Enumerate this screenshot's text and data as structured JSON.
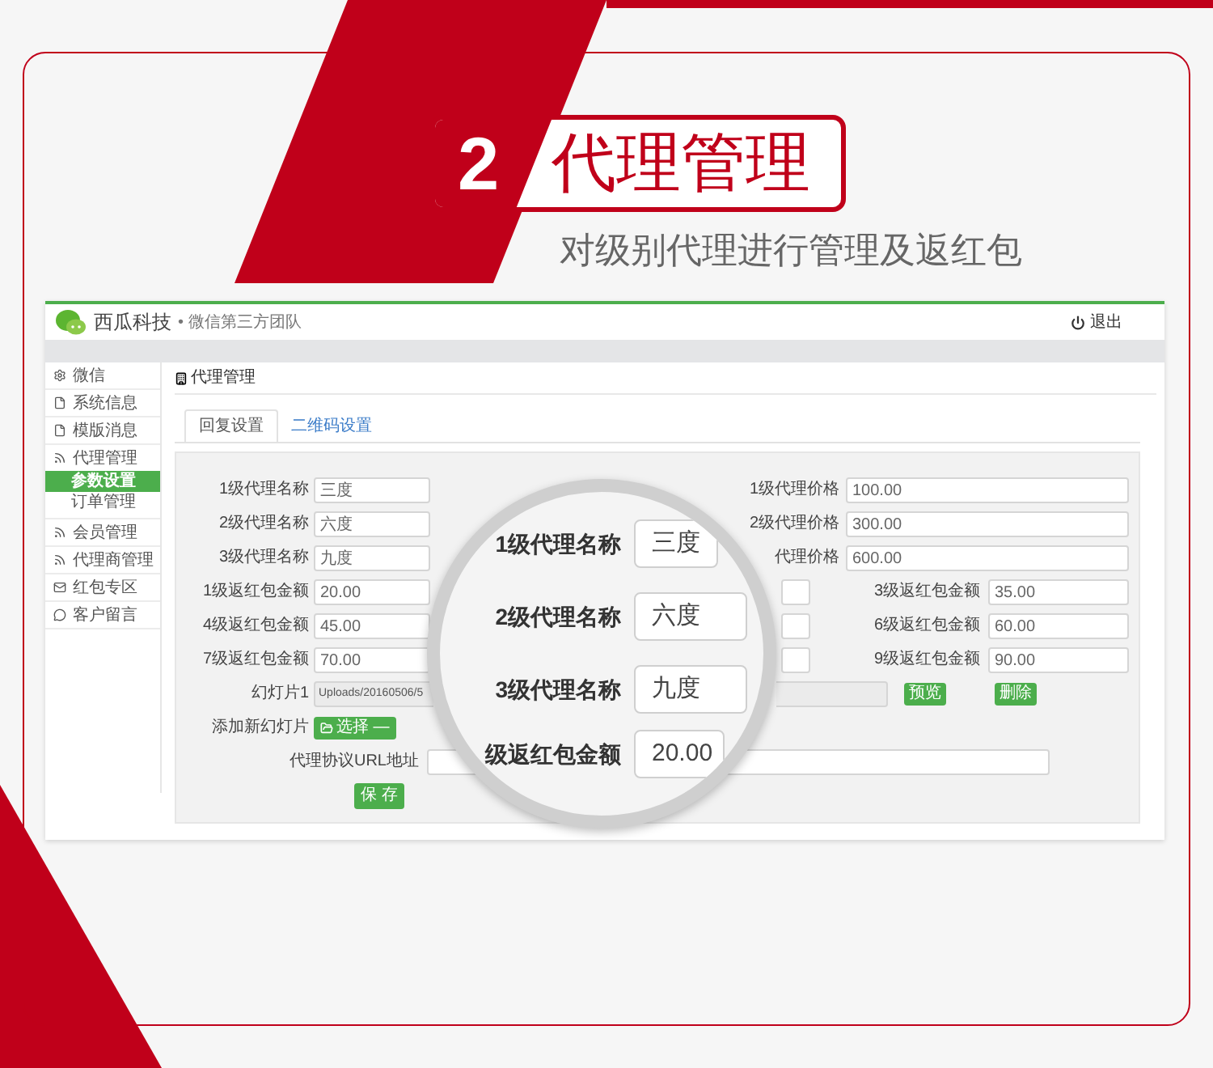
{
  "banner": {
    "number": "2",
    "title": "代理管理",
    "subtitle": "对级别代理进行管理及返红包"
  },
  "app": {
    "brand": "西瓜科技",
    "tagline": "• 微信第三方团队",
    "logout": "退出"
  },
  "sidebar": [
    {
      "label": "微信",
      "selected": false
    },
    {
      "label": "系统信息",
      "selected": false
    },
    {
      "label": "模版消息",
      "selected": false
    },
    {
      "label": "代理管理",
      "selected": false,
      "children": [
        {
          "label": "参数设置",
          "selected": true
        },
        {
          "label": "订单管理",
          "selected": false
        }
      ]
    },
    {
      "label": "会员管理",
      "selected": false
    },
    {
      "label": "代理商管理",
      "selected": false
    },
    {
      "label": "红包专区",
      "selected": false
    },
    {
      "label": "客户留言",
      "selected": false
    }
  ],
  "page_title": "代理管理",
  "tabs": [
    {
      "label": "回复设置",
      "selected": true
    },
    {
      "label": "二维码设置",
      "selected": false
    }
  ],
  "form": {
    "name_rows": [
      {
        "label": "1级代理名称",
        "value": "三度",
        "price_label": "1级代理价格",
        "price": "100.00"
      },
      {
        "label": "2级代理名称",
        "value": "六度",
        "price_label": "2级代理价格",
        "price": "300.00"
      },
      {
        "label": "3级代理名称",
        "value": "九度",
        "price_label": "代理价格",
        "price": "600.00"
      }
    ],
    "bonus_rows": [
      {
        "label": "1级返红包金额",
        "value": "20.00",
        "right_label": "3级返红包金额",
        "right_value": "35.00"
      },
      {
        "label": "4级返红包金额",
        "value": "45.00",
        "right_label": "6级返红包金额",
        "right_value": "60.00"
      },
      {
        "label": "7级返红包金额",
        "value": "70.00",
        "right_label": "9级返红包金额",
        "right_value": "90.00"
      }
    ],
    "slide": {
      "label": "幻灯片1",
      "value": "Uploads/20160506/5",
      "preview": "预览",
      "delete": "删除"
    },
    "add_slide": {
      "label": "添加新幻灯片",
      "button": "选择 —"
    },
    "url": {
      "label": "代理协议URL地址"
    },
    "save": "保 存"
  },
  "magnifier": {
    "rows": [
      {
        "label": "1级代理名称",
        "value": "三度"
      },
      {
        "label": "2级代理名称",
        "value": "六度"
      },
      {
        "label": "3级代理名称",
        "value": "九度"
      },
      {
        "label": "级返红包金额",
        "value": "20.00"
      }
    ]
  }
}
